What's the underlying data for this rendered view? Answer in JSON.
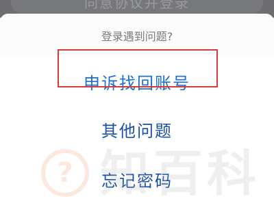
{
  "background": {
    "login_button_label": "同意协议并登录"
  },
  "sheet": {
    "title": "登录遇到问题?",
    "options": [
      {
        "label": "申诉找回账号",
        "highlighted": true
      },
      {
        "label": "其他问题"
      },
      {
        "label": "忘记密码"
      }
    ]
  },
  "watermark": {
    "icon_glyph": "?",
    "text": "知百科"
  },
  "colors": {
    "option_primary": "#1a6fd0",
    "option_text": "#1a4fa8",
    "highlight_border": "#d33a3a",
    "title_text": "#7a7a7c"
  }
}
